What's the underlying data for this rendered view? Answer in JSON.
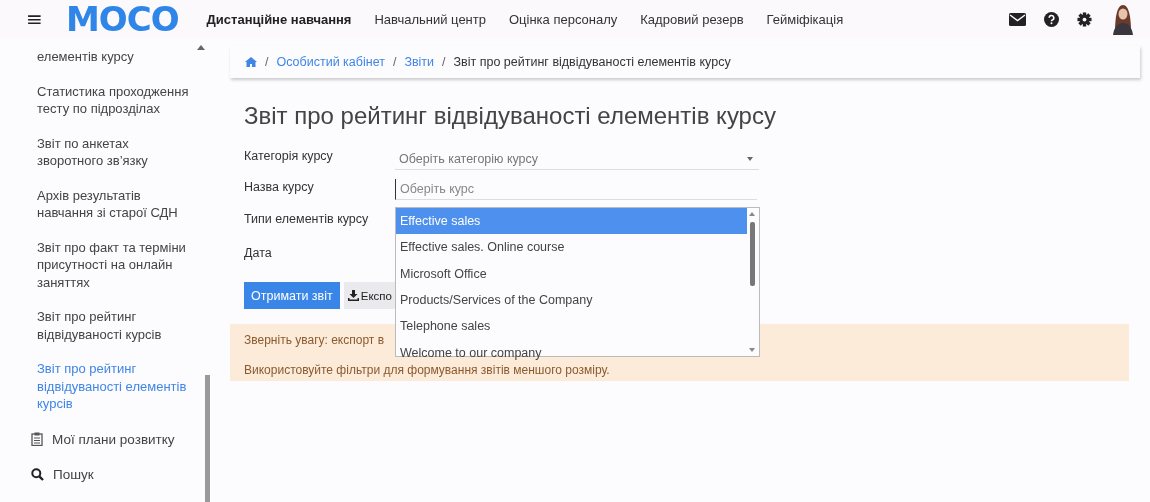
{
  "header": {
    "menu_icon": "≡",
    "logo": "MOCO",
    "nav": [
      {
        "label": "Дистанційне навчання",
        "selected": true
      },
      {
        "label": "Навчальний центр",
        "selected": false
      },
      {
        "label": "Оцінка персоналу",
        "selected": false
      },
      {
        "label": "Кадровий резерв",
        "selected": false
      },
      {
        "label": "Гейміфікація",
        "selected": false
      }
    ]
  },
  "sidebar": {
    "items": [
      {
        "kind": "link",
        "label": "елементів курсу",
        "selected": false
      },
      {
        "kind": "link",
        "label": "Статистика проходження тесту по підрозділах",
        "selected": false
      },
      {
        "kind": "link",
        "label": "Звіт по анкетах зворотного зв’язку",
        "selected": false
      },
      {
        "kind": "link",
        "label": "Архів результатів навчання зі старої СДН",
        "selected": false
      },
      {
        "kind": "link",
        "label": "Звіт про факт та терміни присутності на онлайн заняттях",
        "selected": false
      },
      {
        "kind": "link",
        "label": "Звіт про рейтинг відвідуваності курсів",
        "selected": false
      },
      {
        "kind": "link",
        "label": "Звіт про рейтинг відвідуваності елементів курсів",
        "selected": true
      },
      {
        "kind": "plans",
        "label": "Мої плани розвитку",
        "selected": false
      },
      {
        "kind": "search",
        "label": "Пошук",
        "selected": false
      }
    ]
  },
  "breadcrumb": [
    {
      "kind": "sep",
      "label": "/"
    },
    {
      "kind": "link",
      "label": "Особистий кабінет"
    },
    {
      "kind": "sep",
      "label": "/"
    },
    {
      "kind": "link",
      "label": "Звіти"
    },
    {
      "kind": "sep",
      "label": "/"
    },
    {
      "kind": "current",
      "label": "Звіт про рейтинг відвідуваності елементів курсу"
    }
  ],
  "title": "Звіт про рейтинг відвідуваності елементів курсу",
  "form": {
    "fields": [
      {
        "kind": "select",
        "label": "Категорія курсу",
        "placeholder": "Оберіть категорію курсу"
      },
      {
        "kind": "input",
        "label": "Назва курсу",
        "placeholder": "Оберіть курс"
      },
      {
        "kind": "hidden",
        "label": "Типи елементів курсу"
      },
      {
        "kind": "hidden",
        "label": "Дата"
      }
    ],
    "dropdown": [
      {
        "label": "Effective sales",
        "selected": true
      },
      {
        "label": "Effective sales. Online course",
        "selected": false
      },
      {
        "label": "Microsoft Office",
        "selected": false
      },
      {
        "label": "Products/Services of the Company",
        "selected": false
      },
      {
        "label": "Telephone sales",
        "selected": false
      },
      {
        "label": "Welcome to our company",
        "selected": false
      }
    ],
    "buttons": [
      {
        "kind": "primary",
        "label": "Отримати звіт"
      },
      {
        "kind": "export",
        "label": "Експо"
      }
    ]
  },
  "notice": [
    "Зверніть увагу: експорт в",
    "Використовуйте фільтри для формування звітів меншого розміру."
  ]
}
